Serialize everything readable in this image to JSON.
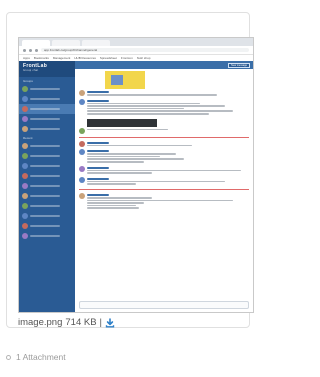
{
  "attachment": {
    "file_name": "image.png",
    "file_size": "714 KB",
    "separator": "|",
    "count_label": "1 Attachment"
  },
  "screenshot": {
    "url": "app.frontlab.ca/group/#/channel/general",
    "bookmarks": [
      "Apps",
      "Bookmarks",
      "Management",
      "HUB Resources",
      "Spreadsheet",
      "Frontcon",
      "Nutri shop"
    ],
    "brand": "FrontLab",
    "brand_sub": "Group chat",
    "new_message_label": "New message",
    "sections": [
      "Groups",
      "Recent"
    ]
  },
  "colors": {
    "sidebar": "#2a5b94",
    "header": "#3a6ea8",
    "download": "#2f80c8"
  }
}
